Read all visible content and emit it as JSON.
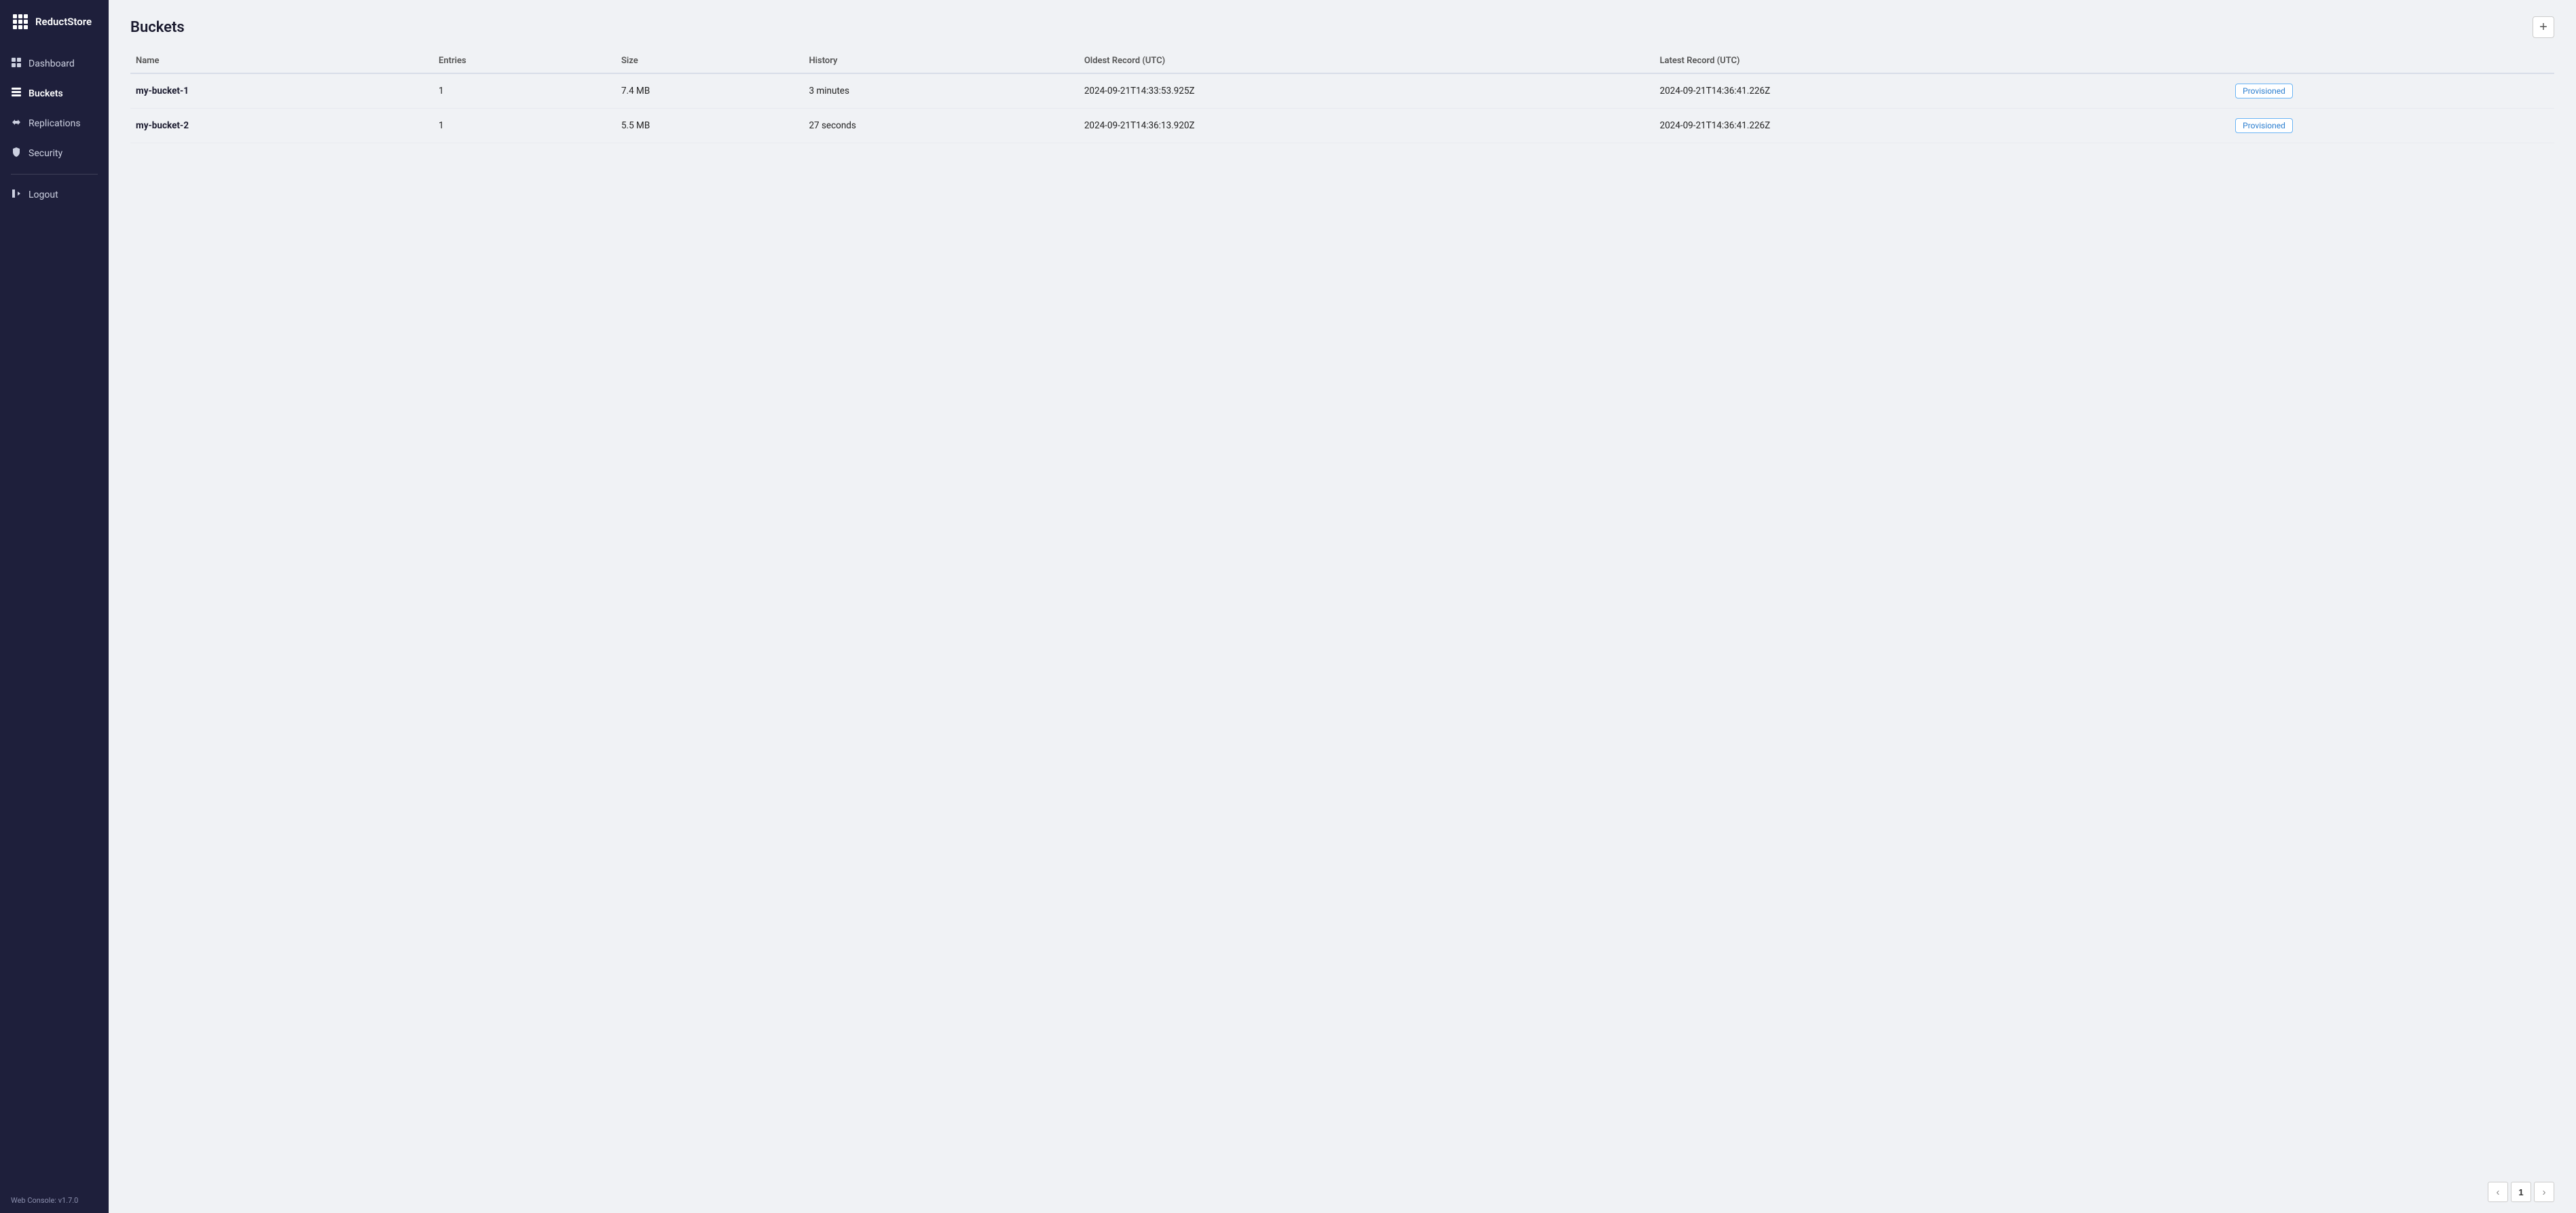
{
  "app": {
    "name": "ReductStore",
    "version_label": "Web Console: v1.7.0"
  },
  "sidebar": {
    "items": [
      {
        "id": "dashboard",
        "label": "Dashboard",
        "icon": "dashboard-icon"
      },
      {
        "id": "buckets",
        "label": "Buckets",
        "icon": "buckets-icon"
      },
      {
        "id": "replications",
        "label": "Replications",
        "icon": "replications-icon"
      },
      {
        "id": "security",
        "label": "Security",
        "icon": "security-icon"
      }
    ],
    "logout_label": "Logout",
    "active": "buckets"
  },
  "page": {
    "title": "Buckets",
    "add_button_label": "+"
  },
  "table": {
    "columns": [
      {
        "id": "name",
        "label": "Name"
      },
      {
        "id": "entries",
        "label": "Entries"
      },
      {
        "id": "size",
        "label": "Size"
      },
      {
        "id": "history",
        "label": "History"
      },
      {
        "id": "oldest_record",
        "label": "Oldest Record (UTC)"
      },
      {
        "id": "latest_record",
        "label": "Latest Record (UTC)"
      }
    ],
    "rows": [
      {
        "name": "my-bucket-1",
        "entries": "1",
        "size": "7.4 MB",
        "history": "3 minutes",
        "oldest_record": "2024-09-21T14:33:53.925Z",
        "latest_record": "2024-09-21T14:36:41.226Z",
        "badge": "Provisioned"
      },
      {
        "name": "my-bucket-2",
        "entries": "1",
        "size": "5.5 MB",
        "history": "27 seconds",
        "oldest_record": "2024-09-21T14:36:13.920Z",
        "latest_record": "2024-09-21T14:36:41.226Z",
        "badge": "Provisioned"
      }
    ]
  },
  "pagination": {
    "prev_label": "‹",
    "next_label": "›",
    "current_page": "1"
  }
}
